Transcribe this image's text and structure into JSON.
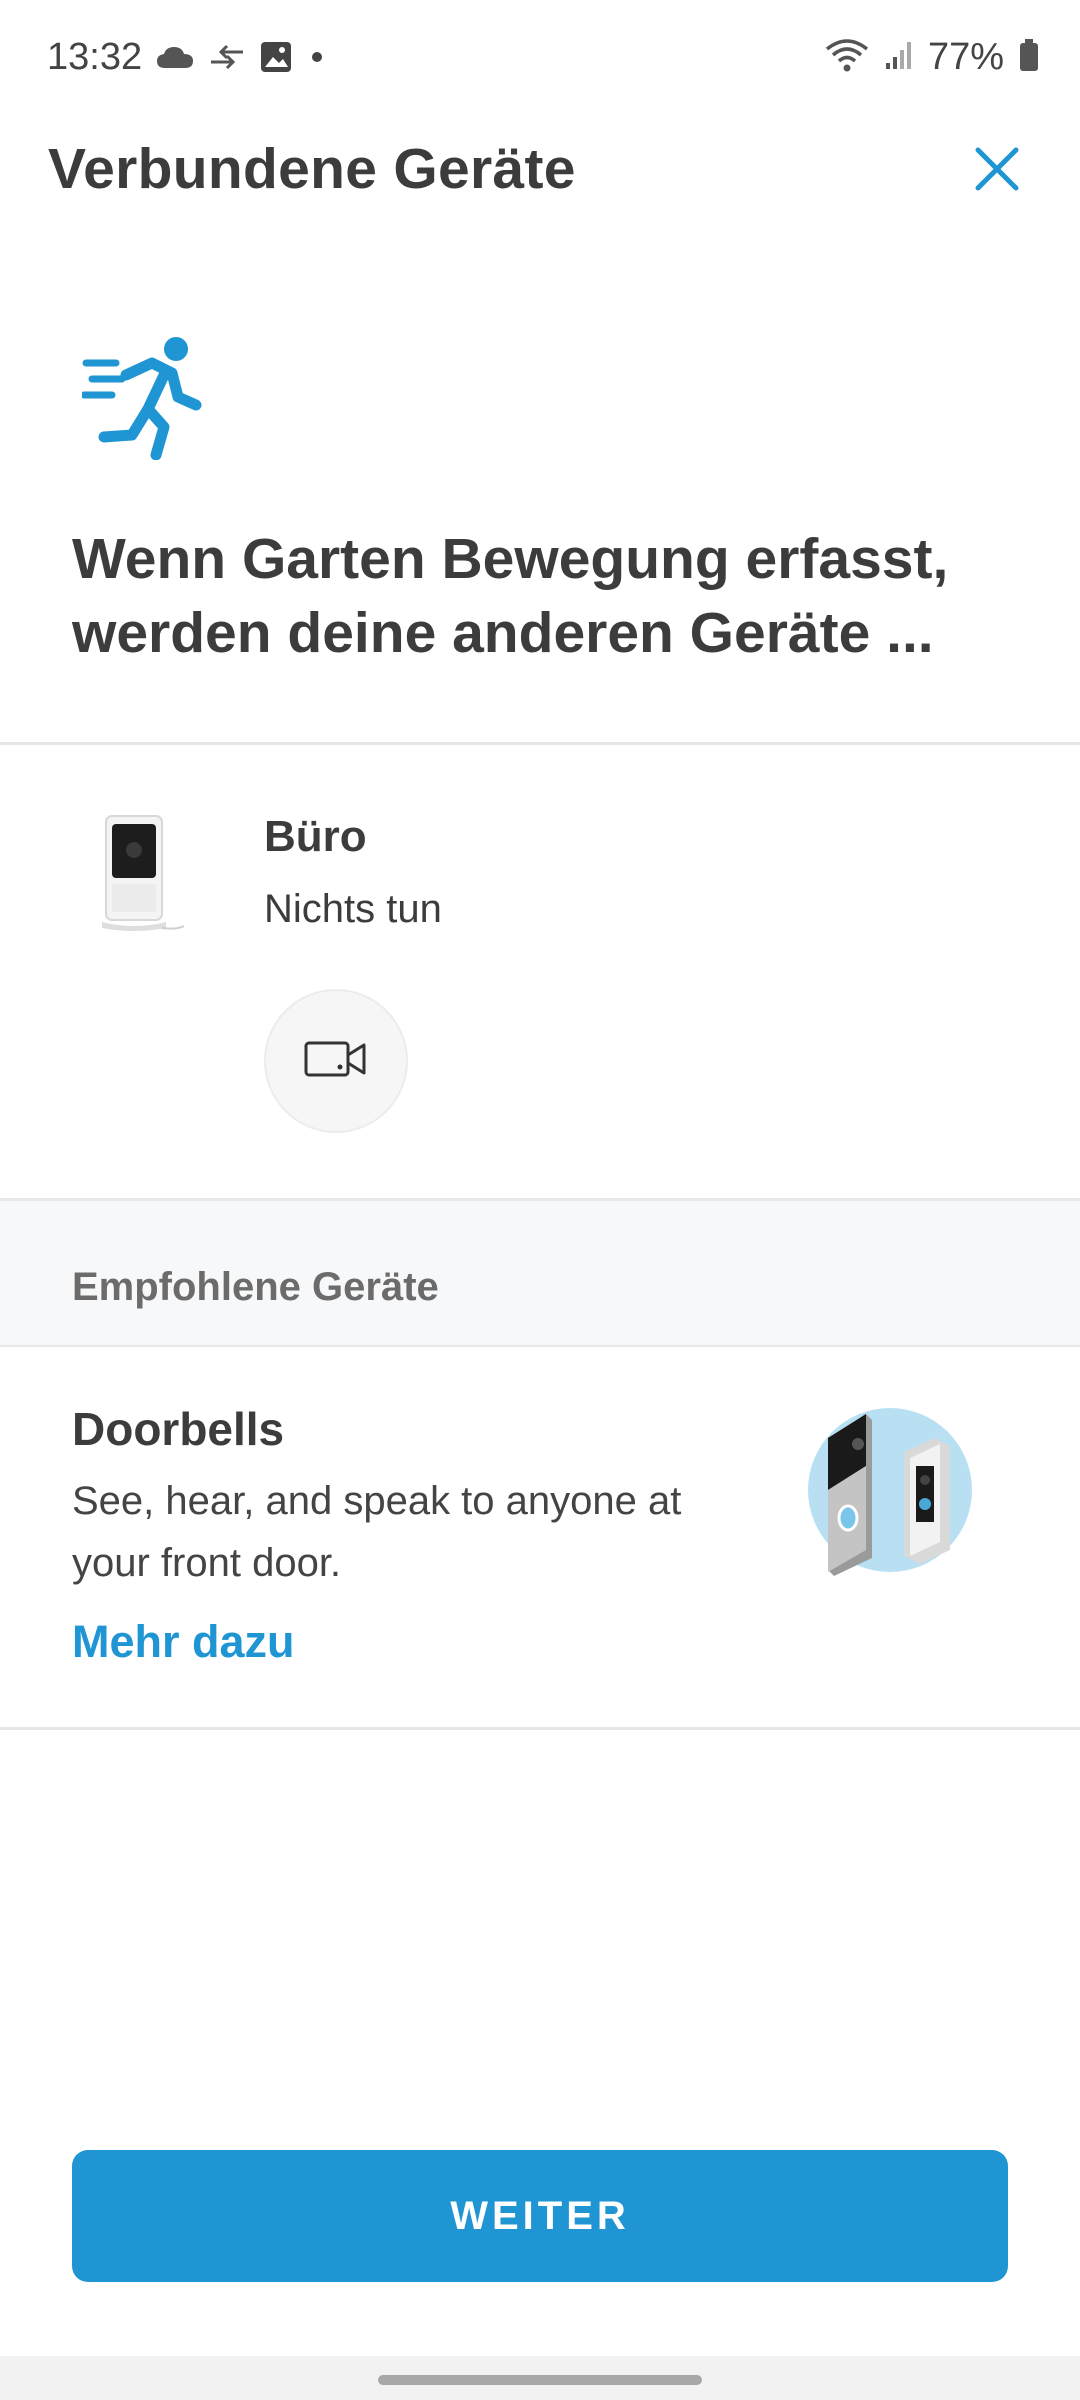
{
  "status_bar": {
    "time": "13:32",
    "battery": "77%",
    "icons": [
      "cloud-icon",
      "sync-icon",
      "image-icon",
      "dot-icon",
      "wifi-icon",
      "signal-icon",
      "battery-icon"
    ]
  },
  "header": {
    "title": "Verbundene Geräte",
    "close_icon": "close-icon"
  },
  "intro": {
    "icon": "running-person-icon",
    "headline": "Wenn Garten Bewegung erfasst, werden deine anderen Geräte ..."
  },
  "device": {
    "name": "Büro",
    "action": "Nichts tun",
    "action_icon": "video-camera-icon"
  },
  "recommended": {
    "section_title": "Empfohlene Geräte",
    "card": {
      "title": "Doorbells",
      "description": "See, hear, and speak to anyone at your front door.",
      "link": "Mehr dazu"
    }
  },
  "footer": {
    "primary_button": "WEITER"
  },
  "colors": {
    "accent": "#1f96d3",
    "text": "#3c3c3c",
    "section_bg": "#f7f8fa"
  }
}
